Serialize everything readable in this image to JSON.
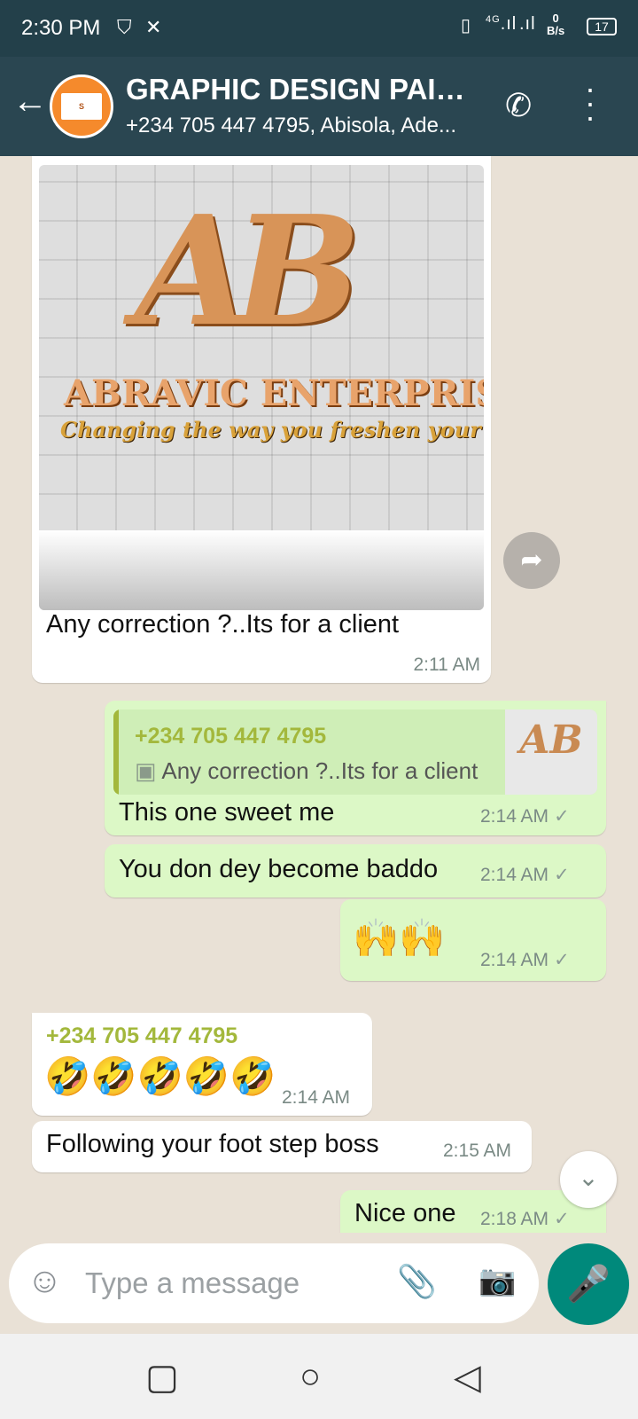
{
  "status_bar": {
    "time": "2:30 PM",
    "left_icons": [
      "shield-icon",
      "x-icon"
    ],
    "network_type": "4G",
    "speed_value": "0",
    "speed_unit": "B/s",
    "battery": "17"
  },
  "header": {
    "title": "GRAPHIC DESIGN PAID...",
    "subtitle": "+234 705 447 4795, Abisola, Ade..."
  },
  "chat": {
    "msg1": {
      "image_brand": "ABRAVIC ENTERPRISE",
      "image_tagline": "Changing the way you freshen your space",
      "image_monogram": "AB",
      "text": "Any correction ?..Its for a client",
      "time": "2:11 AM"
    },
    "msg2": {
      "quote_sender": "+234 705 447 4795",
      "quote_text": "Any correction ?..Its for a client",
      "text": "This one sweet me",
      "time": "2:14 AM"
    },
    "msg3": {
      "text": "You don dey become baddo",
      "time": "2:14 AM"
    },
    "msg4": {
      "text": "🙌🙌",
      "time": "2:14 AM"
    },
    "msg5": {
      "sender": "+234 705 447 4795",
      "text": "🤣🤣🤣🤣🤣",
      "time": "2:14 AM"
    },
    "msg6": {
      "text": "Following your foot step boss",
      "time": "2:15 AM"
    },
    "msg7": {
      "text": "Nice one",
      "time": "2:18 AM"
    }
  },
  "composer": {
    "placeholder": "Type a message"
  },
  "colors": {
    "header_bg": "#2a4651",
    "outgoing_bubble": "#dcf8c6",
    "incoming_bubble": "#ffffff",
    "sender_name": "#a3b83c",
    "mic_button": "#00897b"
  }
}
